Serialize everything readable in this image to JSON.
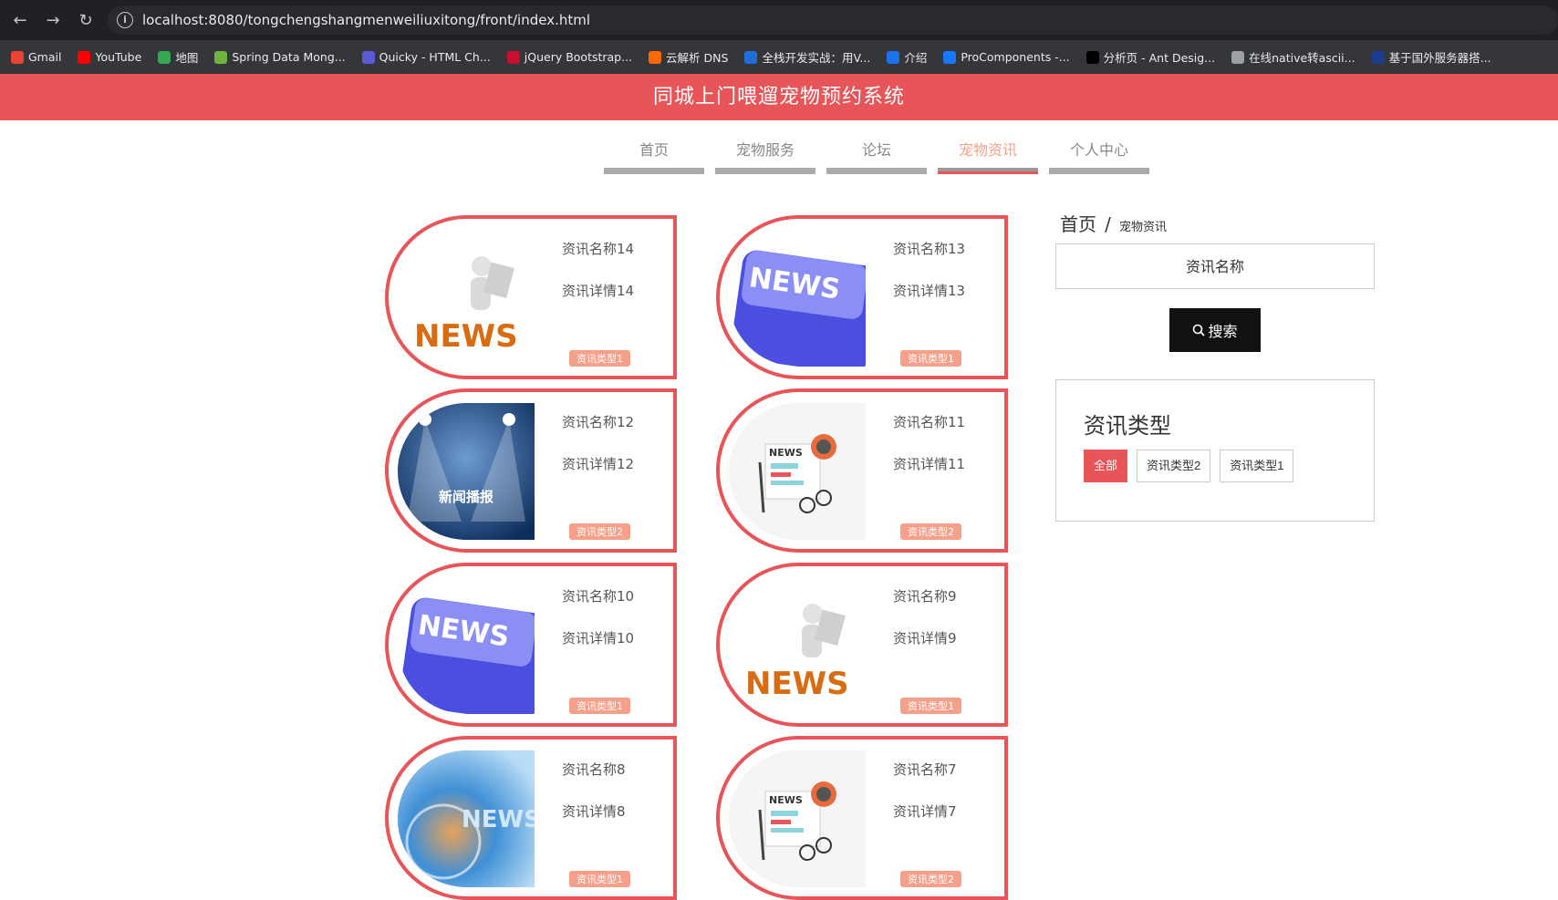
{
  "browser": {
    "url": "localhost:8080/tongchengshangmenweiliuxitong/front/index.html",
    "bookmarks": [
      {
        "label": "Gmail",
        "icon": "gmail-icon",
        "color": "#ea4335"
      },
      {
        "label": "YouTube",
        "icon": "youtube-icon",
        "color": "#ff0000"
      },
      {
        "label": "地图",
        "icon": "maps-icon",
        "color": "#34a853"
      },
      {
        "label": "Spring Data Mong...",
        "icon": "spring-icon",
        "color": "#6db33f"
      },
      {
        "label": "Quicky - HTML Ch...",
        "icon": "quicky-icon",
        "color": "#5b5bd6"
      },
      {
        "label": "jQuery Bootstrap...",
        "icon": "jquery-icon",
        "color": "#c8102e"
      },
      {
        "label": "云解析 DNS",
        "icon": "aliyun-icon",
        "color": "#ff6a00"
      },
      {
        "label": "全栈开发实战：用V...",
        "icon": "m-icon",
        "color": "#1e6fd9"
      },
      {
        "label": "介绍",
        "icon": "globe-icon",
        "color": "#1a73e8"
      },
      {
        "label": "ProComponents -...",
        "icon": "procomponents-icon",
        "color": "#1677ff"
      },
      {
        "label": "分析页 - Ant Desig...",
        "icon": "pro-icon",
        "color": "#000000"
      },
      {
        "label": "在线native转ascii...",
        "icon": "globe-icon",
        "color": "#9aa0a6"
      },
      {
        "label": "基于国外服务器搭...",
        "icon": "flag-icon",
        "color": "#1a3d8f"
      }
    ]
  },
  "site": {
    "title": "同城上门喂遛宠物预约系统"
  },
  "menu": [
    {
      "label": "首页",
      "active": false
    },
    {
      "label": "宠物服务",
      "active": false
    },
    {
      "label": "论坛",
      "active": false
    },
    {
      "label": "宠物资讯",
      "active": true
    },
    {
      "label": "个人中心",
      "active": false
    }
  ],
  "cards": [
    {
      "name": "资讯名称14",
      "detail": "资讯详情14",
      "tag": "资讯类型1",
      "image": "news-man-reading"
    },
    {
      "name": "资讯名称13",
      "detail": "资讯详情13",
      "tag": "资讯类型1",
      "image": "news-key"
    },
    {
      "name": "资讯名称12",
      "detail": "资讯详情12",
      "tag": "资讯类型2",
      "image": "news-broadcast",
      "image_text": "新闻播报"
    },
    {
      "name": "资讯名称11",
      "detail": "资讯详情11",
      "tag": "资讯类型2",
      "image": "newspaper-glasses",
      "image_text": "NEWS"
    },
    {
      "name": "资讯名称10",
      "detail": "资讯详情10",
      "tag": "资讯类型1",
      "image": "news-key"
    },
    {
      "name": "资讯名称9",
      "detail": "资讯详情9",
      "tag": "资讯类型1",
      "image": "news-man-reading"
    },
    {
      "name": "资讯名称8",
      "detail": "资讯详情8",
      "tag": "资讯类型1",
      "image": "news-globe"
    },
    {
      "name": "资讯名称7",
      "detail": "资讯详情7",
      "tag": "资讯类型2",
      "image": "newspaper-glasses",
      "image_text": "NEWS"
    }
  ],
  "sidebar": {
    "breadcrumb_home": "首页",
    "breadcrumb_sep": "/",
    "breadcrumb_current": "宠物资讯",
    "search_placeholder": "资讯名称",
    "search_button": "搜索",
    "type_title": "资讯类型",
    "types": [
      {
        "label": "全部",
        "active": true
      },
      {
        "label": "资讯类型2",
        "active": false
      },
      {
        "label": "资讯类型1",
        "active": false
      }
    ]
  },
  "colors": {
    "primary": "#e85558",
    "tag": "#f5a08a",
    "news_orange": "#d96c12",
    "news_key_blue": "#4a4fe0"
  }
}
